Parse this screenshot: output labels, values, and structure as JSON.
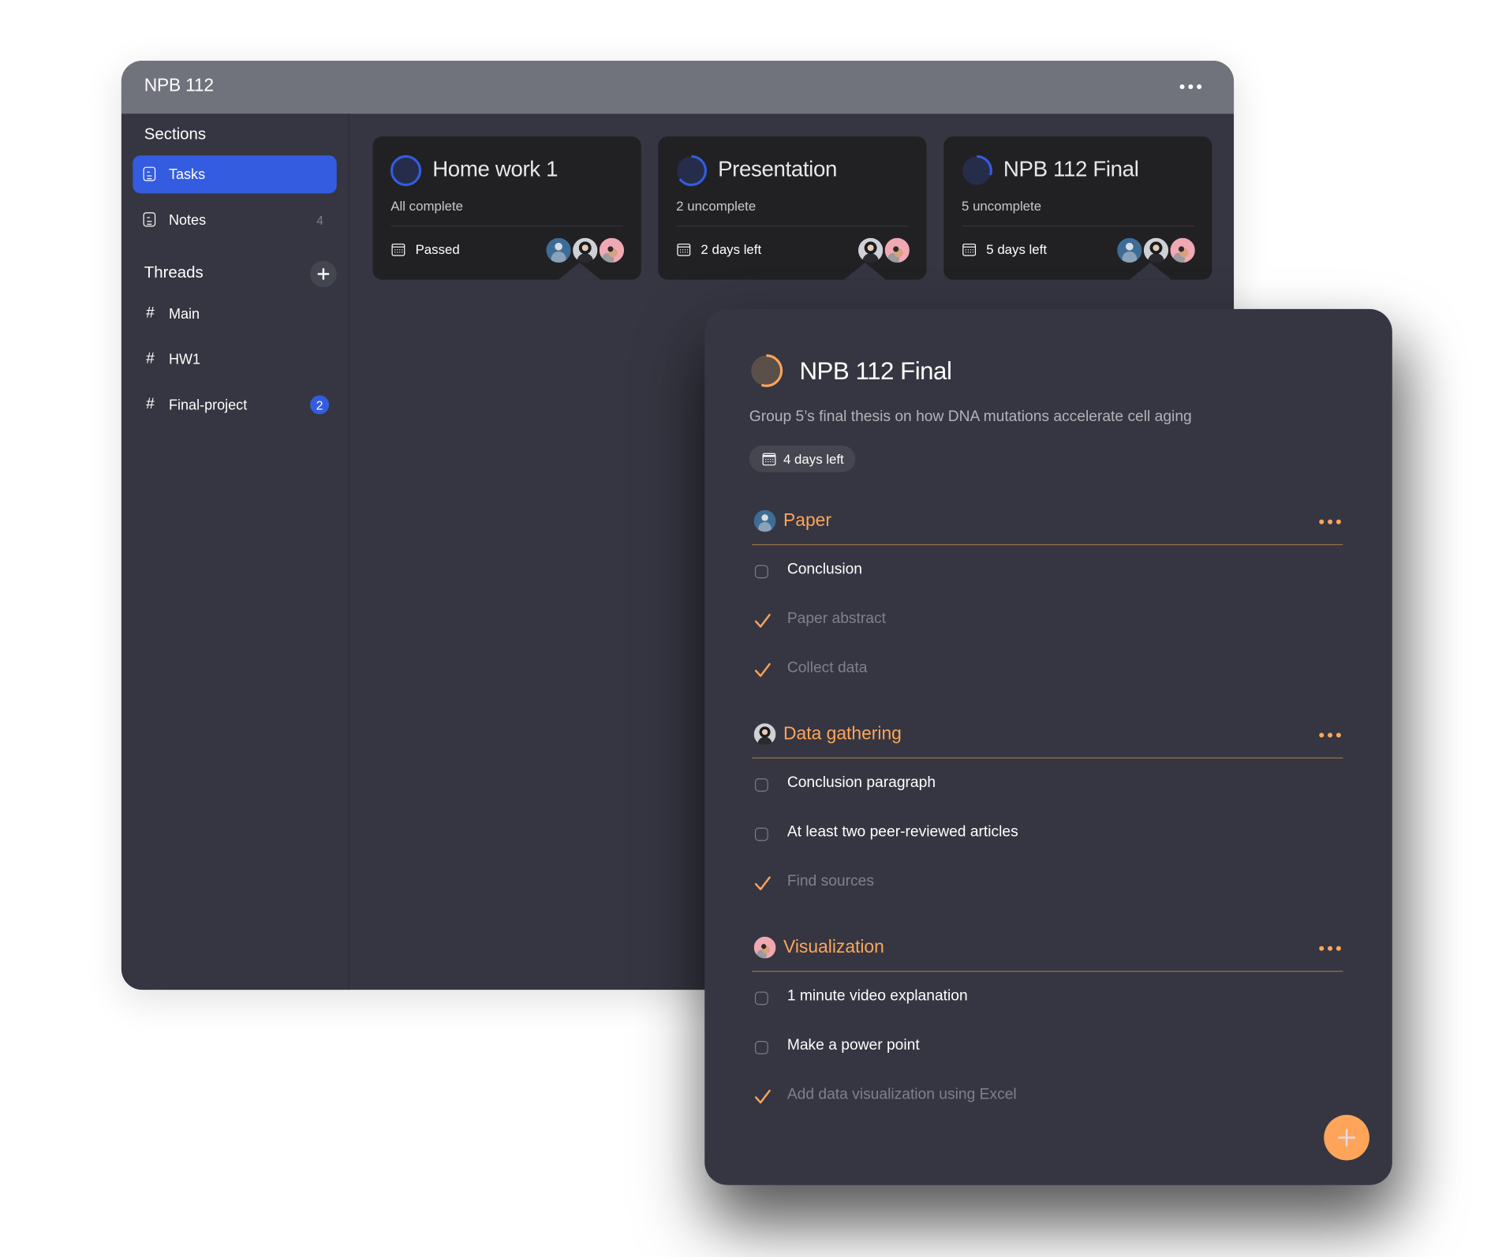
{
  "window": {
    "title": "NPB 112",
    "more_icon": "more-horizontal-icon"
  },
  "sidebar": {
    "sections_heading": "Sections",
    "sections": [
      {
        "label": "Tasks",
        "icon": "document-icon",
        "active": true,
        "count": ""
      },
      {
        "label": "Notes",
        "icon": "document-icon",
        "active": false,
        "count": "4"
      }
    ],
    "threads_heading": "Threads",
    "add_thread_icon": "plus-icon",
    "threads": [
      {
        "label": "Main",
        "icon": "hash-icon",
        "badge": ""
      },
      {
        "label": "HW1",
        "icon": "hash-icon",
        "badge": ""
      },
      {
        "label": "Final-project",
        "icon": "hash-icon",
        "badge": "2"
      }
    ]
  },
  "cards": [
    {
      "title": "Home work 1",
      "status": "All complete",
      "due": "Passed",
      "progress": 1.0,
      "avatars": [
        "a1",
        "a2",
        "a3"
      ]
    },
    {
      "title": "Presentation",
      "status": "2 uncomplete",
      "due": "2 days left",
      "progress": 0.65,
      "avatars": [
        "a2",
        "a3"
      ]
    },
    {
      "title": "NPB 112 Final",
      "status": "5 uncomplete",
      "due": "5 days left",
      "progress": 0.3,
      "avatars": [
        "a1",
        "a2",
        "a3"
      ]
    }
  ],
  "detail": {
    "title": "NPB 112 Final",
    "progress": 0.55,
    "description": "Group 5’s final thesis on how DNA mutations accelerate cell aging",
    "due": "4 days left",
    "groups": [
      {
        "title": "Paper",
        "avatar": "a1",
        "tasks": [
          {
            "label": "Conclusion",
            "done": false
          },
          {
            "label": "Paper abstract",
            "done": true
          },
          {
            "label": "Collect data",
            "done": true
          }
        ]
      },
      {
        "title": "Data gathering",
        "avatar": "a2",
        "tasks": [
          {
            "label": "Conclusion paragraph",
            "done": false
          },
          {
            "label": "At least two peer-reviewed articles",
            "done": false
          },
          {
            "label": "Find sources",
            "done": true
          }
        ]
      },
      {
        "title": "Visualization",
        "avatar": "a3",
        "tasks": [
          {
            "label": "1 minute video explanation",
            "done": false
          },
          {
            "label": "Make a power point",
            "done": false
          },
          {
            "label": "Add data visualization using Excel",
            "done": true
          }
        ]
      }
    ],
    "add_button_icon": "plus-icon"
  },
  "colors": {
    "accent_blue": "#345ce0",
    "accent_orange": "#ffa55a",
    "titlebar": "#70737b",
    "window_bg": "#353641",
    "card_bg": "#212124"
  }
}
